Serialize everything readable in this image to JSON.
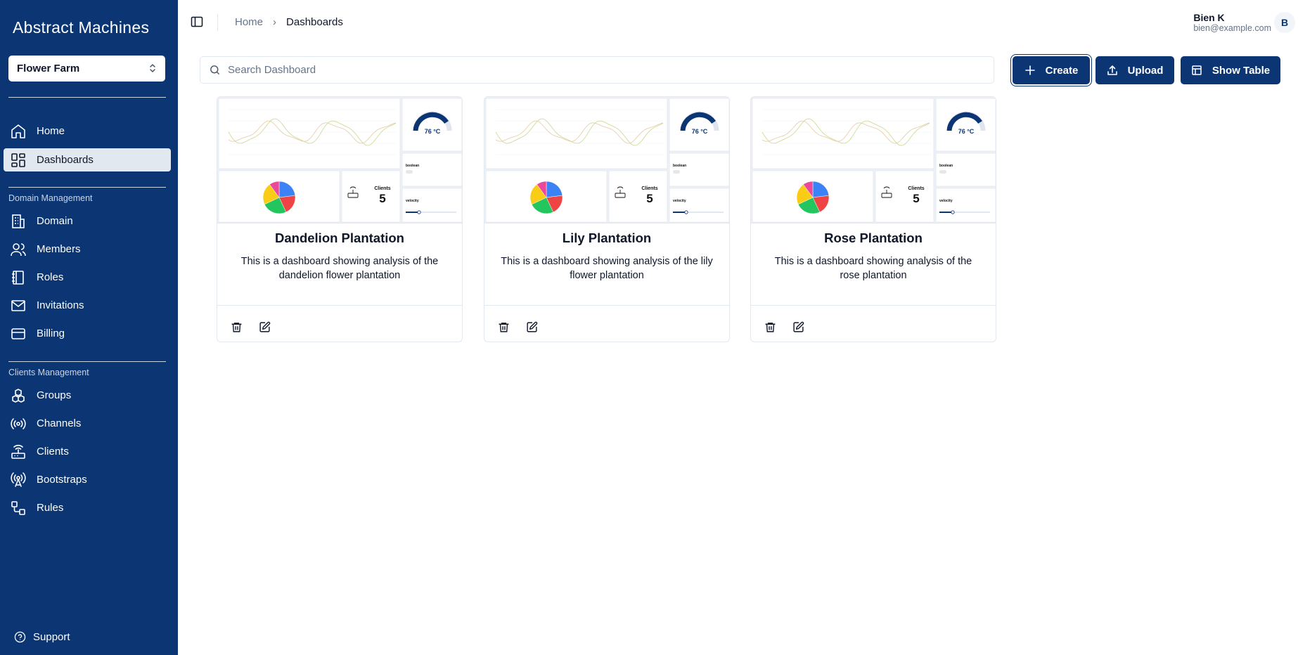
{
  "sidebar": {
    "logo": "Abstract Machines",
    "domain_selector": "Flower Farm",
    "items_top": [
      {
        "label": "Home",
        "icon": "home-icon"
      },
      {
        "label": "Dashboards",
        "icon": "dashboard-icon",
        "active": true
      }
    ],
    "domain_section_label": "Domain Management",
    "domain_items": [
      {
        "label": "Domain",
        "icon": "building-icon"
      },
      {
        "label": "Members",
        "icon": "users-icon"
      },
      {
        "label": "Roles",
        "icon": "book-icon"
      },
      {
        "label": "Invitations",
        "icon": "mail-icon"
      },
      {
        "label": "Billing",
        "icon": "credit-card-icon"
      }
    ],
    "clients_section_label": "Clients Management",
    "client_items": [
      {
        "label": "Groups",
        "icon": "boxes-icon"
      },
      {
        "label": "Channels",
        "icon": "radio-icon"
      },
      {
        "label": "Clients",
        "icon": "router-icon"
      },
      {
        "label": "Bootstraps",
        "icon": "antenna-icon"
      },
      {
        "label": "Rules",
        "icon": "workflow-icon"
      }
    ],
    "support": "Support"
  },
  "header": {
    "breadcrumb_home": "Home",
    "breadcrumb_current": "Dashboards",
    "user_name": "Bien K",
    "user_email": "bien@example.com",
    "avatar_initial": "B"
  },
  "toolbar": {
    "search_placeholder": "Search Dashboard",
    "create_label": "Create",
    "upload_label": "Upload",
    "show_table_label": "Show Table"
  },
  "cards": [
    {
      "title": "Dandelion Plantation",
      "description": "This is a dashboard showing analysis of the dandelion flower plantation"
    },
    {
      "title": "Lily Plantation",
      "description": "This is a dashboard showing analysis of the lily flower plantation"
    },
    {
      "title": "Rose Plantation",
      "description": "This is a dashboard showing analysis of the rose plantation"
    }
  ],
  "thumbnail": {
    "gauge_value": "76 °C",
    "clients_label": "Clients",
    "clients_value": "5",
    "boolean_label": "boolean",
    "velocity_label": "velocity"
  },
  "colors": {
    "sidebar_bg": "#0b3573",
    "primary": "#0b3573",
    "pie": [
      "#3b82f6",
      "#ef4444",
      "#22c55e",
      "#facc15",
      "#ec4899"
    ]
  }
}
